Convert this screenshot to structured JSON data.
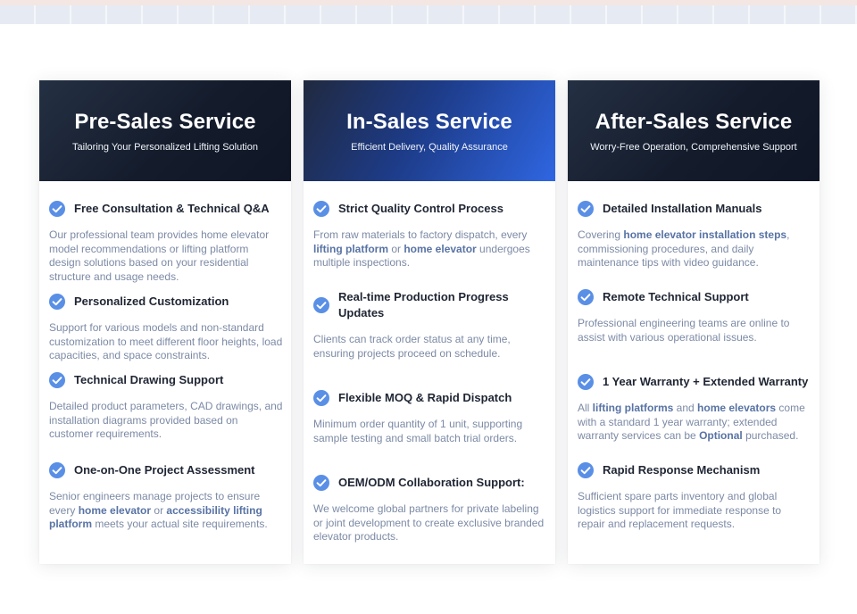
{
  "cards": [
    {
      "title": "Pre-Sales Service",
      "subtitle": "Tailoring Your Personalized Lifting Solution",
      "items": [
        {
          "title": "Free Consultation & Technical Q&A",
          "desc": "Our professional team provides home elevator model recommendations or lifting platform design solutions based on your residential structure and usage needs."
        },
        {
          "title": "Personalized Customization",
          "desc": "Support for various models and non-standard customization to meet different floor heights, load capacities, and space constraints."
        },
        {
          "title": "Technical Drawing Support",
          "desc": "Detailed product parameters, CAD drawings, and installation diagrams provided based on customer requirements."
        },
        {
          "title": "One-on-One Project Assessment",
          "desc": {
            "p1": "Senior engineers manage projects to ensure every ",
            "b1": "home elevator",
            "p2": " or ",
            "b2": "accessibility lifting platform",
            "p3": " meets your actual site requirements."
          }
        }
      ]
    },
    {
      "title": "In-Sales Service",
      "subtitle": "Efficient Delivery, Quality Assurance",
      "items": [
        {
          "title": "Strict Quality Control Process",
          "desc": {
            "p1": "From raw materials to factory dispatch, every ",
            "b1": "lifting platform",
            "p2": " or ",
            "b2": "home elevator",
            "p3": " undergoes multiple inspections."
          }
        },
        {
          "title": "Real-time Production Progress Updates",
          "desc": "Clients can track order status at any time, ensuring projects proceed on schedule."
        },
        {
          "title": "Flexible MOQ & Rapid Dispatch",
          "desc": "Minimum order quantity of 1 unit, supporting sample testing and small batch trial orders."
        },
        {
          "title": "OEM/ODM Collaboration Support:",
          "desc": "We welcome global partners for private labeling or joint development to create exclusive branded elevator products."
        }
      ]
    },
    {
      "title": "After-Sales Service",
      "subtitle": "Worry-Free Operation, Comprehensive Support",
      "items": [
        {
          "title": "Detailed Installation Manuals",
          "desc": {
            "p1": "Covering ",
            "b1": "home elevator installation steps",
            "p2": ", commissioning procedures, and daily maintenance tips with video guidance."
          }
        },
        {
          "title": "Remote Technical Support",
          "desc": "Professional engineering teams are online to assist with various operational issues."
        },
        {
          "title": "1 Year Warranty + Extended Warranty",
          "desc": {
            "p1": "All ",
            "b1": "lifting platforms",
            "p2": " and ",
            "b2": "home elevators",
            "p3": " come with a standard 1 year warranty; extended warranty services can be ",
            "b3": "Optional",
            "p4": " purchased."
          }
        },
        {
          "title": "Rapid Response Mechanism",
          "desc": "Sufficient spare parts inventory and global logistics support for immediate response to repair and replacement requests."
        }
      ]
    }
  ],
  "colors": {
    "check": "#5a8fe6",
    "title_text": "#1f2533",
    "desc_text": "#7c8aa5",
    "highlight_text": "#5873a4"
  },
  "icons": {
    "item_marker": "check-circle-icon"
  }
}
